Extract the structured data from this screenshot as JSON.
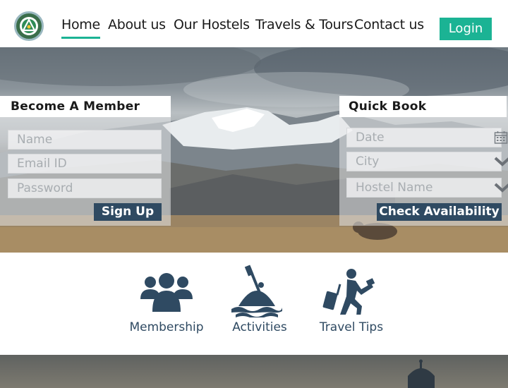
{
  "header": {
    "logo_name": "hostel-logo",
    "nav": [
      {
        "label": "Home",
        "active": true
      },
      {
        "label": "About us",
        "active": false
      },
      {
        "label": "Our Hostels",
        "active": false
      },
      {
        "label": "Travels & Tours",
        "active": false
      },
      {
        "label": "Contact us",
        "active": false
      }
    ],
    "login_label": "Login"
  },
  "member_form": {
    "title": "Become A Member",
    "name_placeholder": "Name",
    "email_placeholder": "Email ID",
    "password_placeholder": "Password",
    "submit_label": "Sign Up"
  },
  "quick_book": {
    "title": "Quick Book",
    "date_placeholder": "Date",
    "city_placeholder": "City",
    "hostel_placeholder": "Hostel Name",
    "submit_label": "Check Availability"
  },
  "features": [
    {
      "label": "Membership",
      "icon": "group-icon"
    },
    {
      "label": "Activities",
      "icon": "kayak-icon"
    },
    {
      "label": "Travel Tips",
      "icon": "traveler-icon"
    }
  ],
  "colors": {
    "accent": "#1bb394",
    "dark_button": "#2f4a62"
  }
}
